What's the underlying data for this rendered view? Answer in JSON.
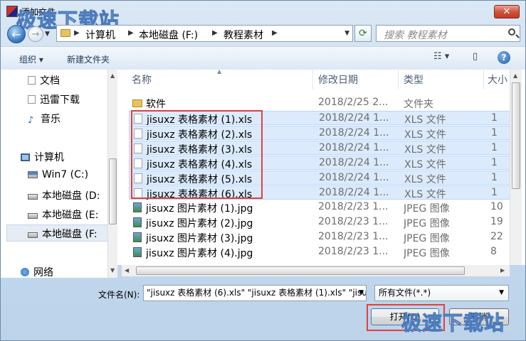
{
  "title": "添加文件",
  "watermark": "极速下载站",
  "nav": {
    "breadcrumbs": [
      "计算机",
      "本地磁盘 (F:)",
      "教程素材"
    ],
    "search_placeholder": "搜索 教程素材"
  },
  "toolbar": {
    "organize": "组织 ▾",
    "new_folder": "新建文件夹"
  },
  "sidebar": {
    "items": [
      {
        "label": "文档",
        "icon": "document-icon"
      },
      {
        "label": "迅雷下载",
        "icon": "document-icon"
      },
      {
        "label": "音乐",
        "icon": "music-icon"
      },
      {
        "label": "计算机",
        "icon": "computer-icon"
      },
      {
        "label": "Win7 (C:)",
        "icon": "drive-icon"
      },
      {
        "label": "本地磁盘 (D:",
        "icon": "drive-icon"
      },
      {
        "label": "本地磁盘 (E:",
        "icon": "drive-icon"
      },
      {
        "label": "本地磁盘 (F:",
        "icon": "drive-icon"
      },
      {
        "label": "网络",
        "icon": "network-icon"
      }
    ]
  },
  "columns": {
    "name": "名称",
    "date": "修改日期",
    "type": "类型",
    "size": "大小"
  },
  "files": [
    {
      "name": "软件",
      "date": "2018/2/25 2...",
      "type": "文件夹",
      "size": "",
      "kind": "folder",
      "selected": false
    },
    {
      "name": "jisuxz 表格素材 (1).xls",
      "date": "2018/2/24 1...",
      "type": "XLS 文件",
      "size": "1",
      "kind": "xls",
      "selected": true
    },
    {
      "name": "jisuxz 表格素材 (2).xls",
      "date": "2018/2/24 1...",
      "type": "XLS 文件",
      "size": "1",
      "kind": "xls",
      "selected": true
    },
    {
      "name": "jisuxz 表格素材 (3).xls",
      "date": "2018/2/24 1...",
      "type": "XLS 文件",
      "size": "1",
      "kind": "xls",
      "selected": true
    },
    {
      "name": "jisuxz 表格素材 (4).xls",
      "date": "2018/2/24 1...",
      "type": "XLS 文件",
      "size": "1",
      "kind": "xls",
      "selected": true
    },
    {
      "name": "jisuxz 表格素材 (5).xls",
      "date": "2018/2/24 1...",
      "type": "XLS 文件",
      "size": "1",
      "kind": "xls",
      "selected": true
    },
    {
      "name": "jisuxz 表格素材 (6).xls",
      "date": "2018/2/24 1...",
      "type": "XLS 文件",
      "size": "1",
      "kind": "xls",
      "selected": true
    },
    {
      "name": "jisuxz 图片素材 (1).jpg",
      "date": "2018/2/23 1...",
      "type": "JPEG 图像",
      "size": "10",
      "kind": "jpg",
      "selected": false
    },
    {
      "name": "jisuxz 图片素材 (2).jpg",
      "date": "2018/2/23 1...",
      "type": "JPEG 图像",
      "size": "19",
      "kind": "jpg",
      "selected": false
    },
    {
      "name": "jisuxz 图片素材 (3).jpg",
      "date": "2018/2/23 1...",
      "type": "JPEG 图像",
      "size": "22",
      "kind": "jpg",
      "selected": false
    },
    {
      "name": "jisuxz 图片素材 (4).jpg",
      "date": "2018/2/23 1...",
      "type": "JPEG 图像",
      "size": "8",
      "kind": "jpg",
      "selected": false
    }
  ],
  "bottom": {
    "filename_label": "文件名(N):",
    "filename_value": "\"jisuxz 表格素材 (6).xls\" \"jisuxz 表格素材 (1).xls\" \"jisu",
    "filetype": "所有文件(*.*)",
    "open_label": "打开(O)",
    "cancel_label": "取消"
  }
}
